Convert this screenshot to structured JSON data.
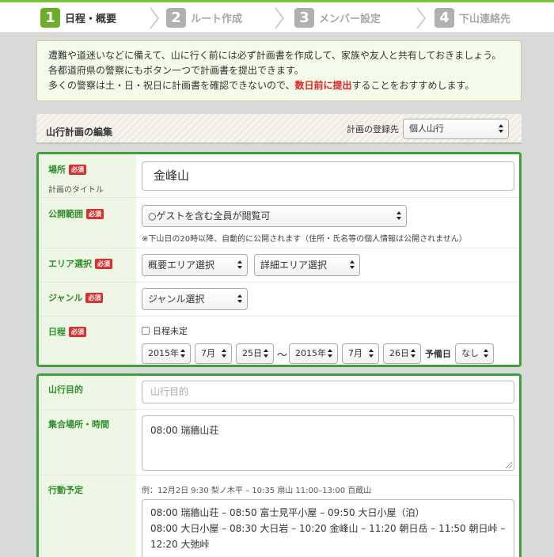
{
  "steps": [
    {
      "num": "1",
      "label": "日程・概要"
    },
    {
      "num": "2",
      "label": "ルート作成"
    },
    {
      "num": "3",
      "label": "メンバー設定"
    },
    {
      "num": "4",
      "label": "下山連絡先"
    }
  ],
  "notice": {
    "line1": "遭難や道迷いなどに備えて、山に行く前には必ず計画書を作成して、家族や友人と共有しておきましょう。",
    "line2": "各都道府県の警察にもボタン一つで計画書を提出できます。",
    "line3_a": "多くの警察は土・日・祝日に計画書を確認できないので、",
    "line3_red": "数日前に提出",
    "line3_b": "することをおすすめします。"
  },
  "section": {
    "title": "山行計画の編集",
    "reg_label": "計画の登録先",
    "reg_value": "個人山行"
  },
  "required_badge": "必須",
  "form1": {
    "place": {
      "label": "場所",
      "sub": "計画のタイトル",
      "value": "金峰山"
    },
    "visibility": {
      "label": "公開範囲",
      "value": "○ゲストを含む全員が閲覧可",
      "note": "※下山日の20時以降、自動的に公開されます（住所・氏名等の個人情報は公開されません）"
    },
    "area": {
      "label": "エリア選択",
      "overview": "概要エリア選択",
      "detail": "詳細エリア選択"
    },
    "genre": {
      "label": "ジャンル",
      "value": "ジャンル選択"
    },
    "schedule": {
      "label": "日程",
      "undecided": "日程未定",
      "start_year": "2015年",
      "start_month": "7月",
      "start_day": "25日",
      "tilde": "〜",
      "end_year": "2015年",
      "end_month": "7月",
      "end_day": "26日",
      "reserve_label": "予備日",
      "reserve_value": "なし"
    }
  },
  "form2": {
    "purpose": {
      "label": "山行目的",
      "placeholder": "山行目的"
    },
    "meeting": {
      "label": "集合場所・時間",
      "value": "08:00 瑞牆山荘"
    },
    "plan": {
      "label": "行動予定",
      "example": "例：12月2日 9:30 梨ノ木平 – 10:35 扇山 11:00–13:00 百蔵山",
      "line1": "08:00 瑞牆山荘 – 08:50 富士見平小屋 – 09:50 大日小屋（泊）",
      "line2": "08:00 大日小屋 – 08:30 大日岩 – 10:20 金峰山 – 11:20 朝日岳 – 11:50 朝日峠 –",
      "line3": "12:20 大弛峠"
    }
  },
  "colors": {
    "accent_green": "#3ca33a",
    "step_active": "#6cae2a",
    "required_red": "#d93030",
    "highlight_red": "#e81f1f"
  }
}
